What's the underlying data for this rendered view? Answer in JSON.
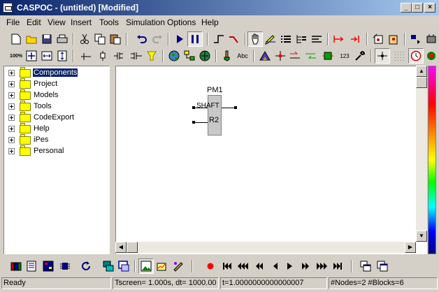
{
  "window": {
    "title": "CASPOC - (untitled) [Modified]",
    "controls": {
      "minimize": "_",
      "maximize": "□",
      "close": "×"
    }
  },
  "menu": [
    "File",
    "Edit",
    "View",
    "Insert",
    "Tools",
    "Simulation",
    "Options",
    "Help"
  ],
  "toolbar1": {
    "icons": [
      "new-document-icon",
      "open-folder-icon",
      "save-icon",
      "print-icon",
      "cut-icon",
      "copy-icon",
      "paste-icon",
      "undo-icon",
      "redo-icon",
      "run-simulation-icon",
      "pause-simulation-icon",
      "wire-tool-icon",
      "draw-line-icon",
      "hand-pan-icon",
      "edit-block-icon",
      "list-icon",
      "tree-icon",
      "align-icon",
      "probe-icon",
      "link-icon",
      "cut-diagram-icon",
      "paste-diagram-icon",
      "flip-icon",
      "component-icon"
    ]
  },
  "toolbar2": {
    "zoom_100_label": "100%",
    "text_tool_label": "Abc",
    "numeric_label": "123",
    "icons": [
      "zoom-100-icon",
      "zoom-fit-icon",
      "zoom-width-icon",
      "zoom-height-icon",
      "node-icon",
      "terminal-icon",
      "split-icon",
      "join-icon",
      "funnel-icon",
      "globe-icon",
      "network-icon",
      "web-icon",
      "brush-icon",
      "text-tool-icon",
      "model-icon",
      "cross-node-icon",
      "arrow-right-icon",
      "arrow-left-icon",
      "switch-icon",
      "numeric-display-icon",
      "wrench-icon",
      "dot-node-icon",
      "grid-icon",
      "clock-icon",
      "color-icon"
    ]
  },
  "tree": {
    "items": [
      {
        "label": "Components",
        "selected": true
      },
      {
        "label": "Project",
        "selected": false
      },
      {
        "label": "Models",
        "selected": false
      },
      {
        "label": "Tools",
        "selected": false
      },
      {
        "label": "CodeExport",
        "selected": false
      },
      {
        "label": "Help",
        "selected": false
      },
      {
        "label": "iPes",
        "selected": false
      },
      {
        "label": "Personal",
        "selected": false
      }
    ]
  },
  "canvas": {
    "block": {
      "name": "PM1",
      "shaft_label": "SHAFT",
      "r2_label": "R2"
    }
  },
  "bottom_toolbar": {
    "icons": [
      "library-icon",
      "document-icon",
      "schematic-icon",
      "chip-icon",
      "refresh-icon",
      "scope-icon",
      "sub-scope-icon",
      "image-icon",
      "plot-icon",
      "palette-icon",
      "record-icon",
      "goto-start-icon",
      "fast-rewind-icon",
      "rewind-icon",
      "step-back-icon",
      "play-icon",
      "step-forward-icon",
      "fast-forward-icon",
      "goto-end-icon",
      "window-cascade-icon",
      "window-tile-icon"
    ]
  },
  "status": {
    "ready": "Ready",
    "tscreen": "Tscreen= 1.000s, dt= 1000.00",
    "t": "t=1.0000000000000007",
    "counts": "#Nodes=2 #Blocks=6"
  }
}
